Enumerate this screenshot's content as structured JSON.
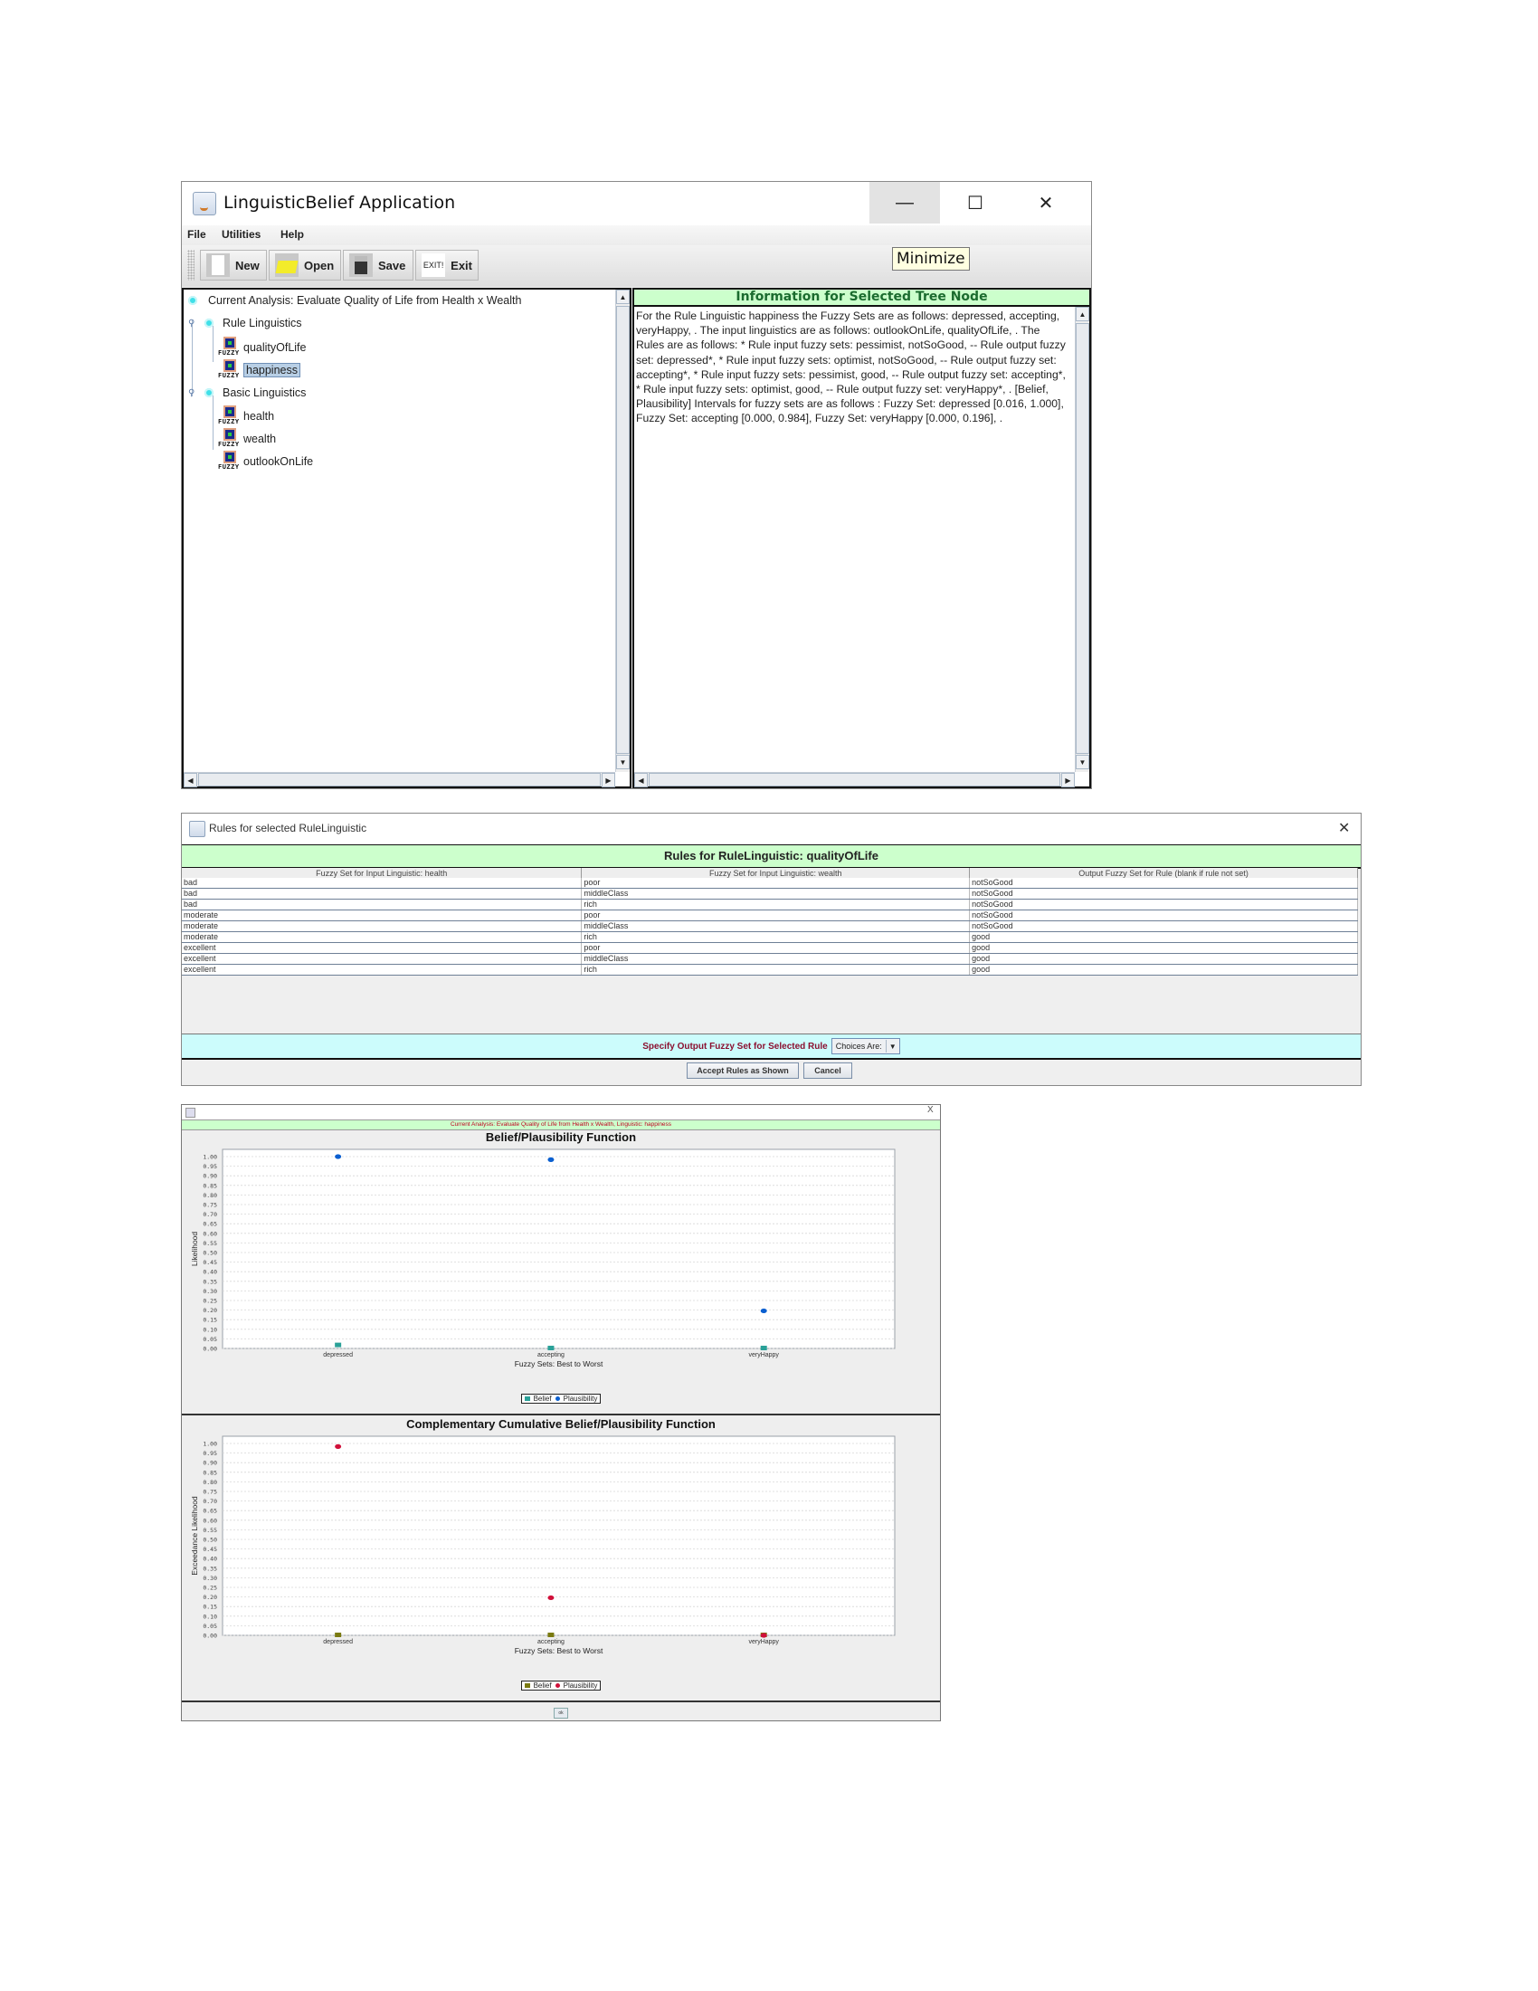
{
  "main_window": {
    "title": "LinguisticBelief Application",
    "window_controls": {
      "minimize": "—",
      "maximize": "☐",
      "close": "✕"
    },
    "tooltip": "Minimize",
    "menu": [
      "File",
      "Utilities",
      "Help"
    ],
    "toolbar": [
      {
        "label": "New",
        "icon": "new-file-icon"
      },
      {
        "label": "Open",
        "icon": "open-folder-icon"
      },
      {
        "label": "Save",
        "icon": "save-disk-icon"
      },
      {
        "label": "Exit",
        "icon": "exit-icon",
        "icon_text": "EXIT!"
      }
    ],
    "tree": {
      "root": "Current Analysis: Evaluate Quality of Life from Health x Wealth",
      "groups": [
        {
          "label": "Rule Linguistics",
          "children": [
            "qualityOfLife",
            "happiness"
          ]
        },
        {
          "label": "Basic Linguistics",
          "children": [
            "health",
            "wealth",
            "outlookOnLife"
          ]
        }
      ],
      "selected": "happiness",
      "fuzzy_badge": "FUZZY"
    },
    "info_panel": {
      "header": "Information for Selected Tree Node",
      "text": "For the Rule Linguistic happiness the Fuzzy Sets are as follows: depressed, accepting, veryHappy, .  The input linguistics are as follows: outlookOnLife, qualityOfLife, .  The Rules are as follows: * Rule input fuzzy sets: pessimist, notSoGood, -- Rule output fuzzy set: depressed*, * Rule input fuzzy sets: optimist, notSoGood, -- Rule output fuzzy set: accepting*, * Rule input fuzzy sets: pessimist, good, -- Rule output fuzzy set: accepting*, * Rule input fuzzy sets: optimist, good, -- Rule output fuzzy set: veryHappy*, . [Belief, Plausibility] Intervals for fuzzy sets are as follows : Fuzzy Set: depressed [0.016, 1.000], Fuzzy Set: accepting [0.000, 0.984], Fuzzy Set: veryHappy [0.000, 0.196], ."
    },
    "scroll_arrows": {
      "up": "▲",
      "down": "▼",
      "left": "◀",
      "right": "▶"
    }
  },
  "rules_dialog": {
    "title": "Rules for selected RuleLinguistic",
    "close": "✕",
    "header": "Rules for RuleLinguistic: qualityOfLife",
    "columns": [
      "Fuzzy Set for Input Linguistic: health",
      "Fuzzy Set for Input Linguistic: wealth",
      "Output Fuzzy Set for Rule (blank if rule not set)"
    ],
    "rows": [
      [
        "bad",
        "poor",
        "notSoGood"
      ],
      [
        "bad",
        "middleClass",
        "notSoGood"
      ],
      [
        "bad",
        "rich",
        "notSoGood"
      ],
      [
        "moderate",
        "poor",
        "notSoGood"
      ],
      [
        "moderate",
        "middleClass",
        "notSoGood"
      ],
      [
        "moderate",
        "rich",
        "good"
      ],
      [
        "excellent",
        "poor",
        "good"
      ],
      [
        "excellent",
        "middleClass",
        "good"
      ],
      [
        "excellent",
        "rich",
        "good"
      ]
    ],
    "specify_label": "Specify Output Fuzzy Set for Selected Rule",
    "choices_value": "Choices Are:",
    "accept_button": "Accept Rules as Shown",
    "cancel_button": "Cancel"
  },
  "chart_window": {
    "close": "X",
    "banner": "Current Analysis: Evaluate Quality of Life from Health x Wealth, Linguistic: happiness",
    "ok_button": "ok"
  },
  "chart_data": [
    {
      "type": "scatter",
      "title": "Belief/Plausibility Function",
      "xlabel": "Fuzzy Sets: Best to Worst",
      "ylabel": "Likelihood",
      "categories": [
        "depressed",
        "accepting",
        "veryHappy"
      ],
      "ylim": [
        0,
        1
      ],
      "yticks": [
        "0.00",
        "0.05",
        "0.10",
        "0.15",
        "0.20",
        "0.25",
        "0.30",
        "0.35",
        "0.40",
        "0.45",
        "0.50",
        "0.55",
        "0.60",
        "0.65",
        "0.70",
        "0.75",
        "0.80",
        "0.85",
        "0.90",
        "0.95",
        "1.00"
      ],
      "grid": true,
      "legend_position": "bottom-center",
      "series": [
        {
          "name": "Belief",
          "marker": "square",
          "color": "#2aa198",
          "values": [
            0.016,
            0.0,
            0.0
          ]
        },
        {
          "name": "Plausibility",
          "marker": "circle",
          "color": "#0a5fd0",
          "values": [
            1.0,
            0.984,
            0.196
          ]
        }
      ]
    },
    {
      "type": "scatter",
      "title": "Complementary Cumulative Belief/Plausibility Function",
      "xlabel": "Fuzzy Sets: Best to Worst",
      "ylabel": "Exceedance Likelihood",
      "categories": [
        "depressed",
        "accepting",
        "veryHappy"
      ],
      "ylim": [
        0,
        1
      ],
      "yticks": [
        "0.00",
        "0.05",
        "0.10",
        "0.15",
        "0.20",
        "0.25",
        "0.30",
        "0.35",
        "0.40",
        "0.45",
        "0.50",
        "0.55",
        "0.60",
        "0.65",
        "0.70",
        "0.75",
        "0.80",
        "0.85",
        "0.90",
        "0.95",
        "1.00"
      ],
      "grid": true,
      "legend_position": "bottom-center",
      "series": [
        {
          "name": "Belief",
          "marker": "square",
          "color": "#7a7a10",
          "values": [
            0.0,
            0.0,
            0.0
          ]
        },
        {
          "name": "Plausibility",
          "marker": "circle",
          "color": "#d0103a",
          "values": [
            0.984,
            0.196,
            0.0
          ]
        }
      ]
    }
  ]
}
